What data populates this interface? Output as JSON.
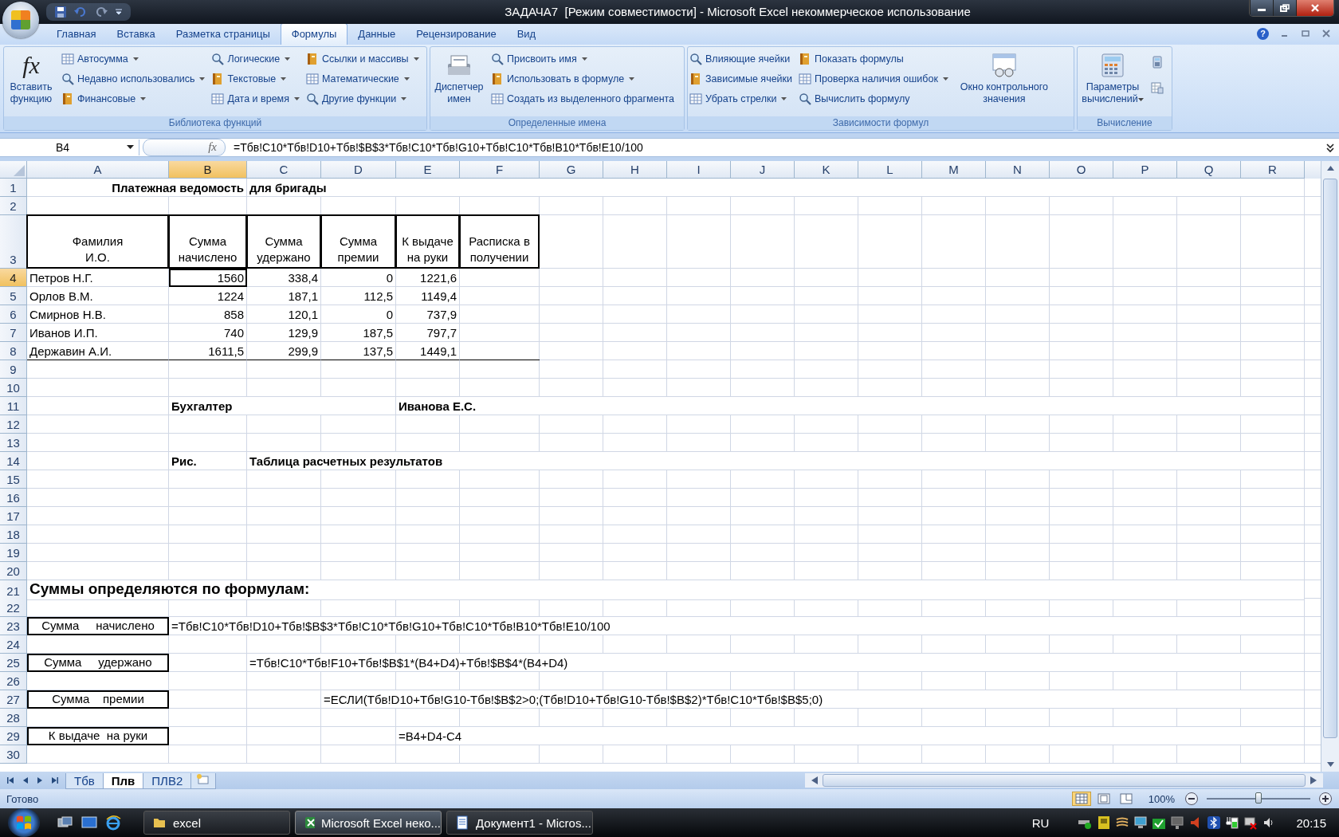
{
  "window": {
    "title": "ЗАДАЧА7  [Режим совместимости] - Microsoft Excel некоммерческое использование"
  },
  "ribbon": {
    "tabs": [
      {
        "label": "Главная",
        "selected": false
      },
      {
        "label": "Вставка",
        "selected": false
      },
      {
        "label": "Разметка страницы",
        "selected": false
      },
      {
        "label": "Формулы",
        "selected": true
      },
      {
        "label": "Данные",
        "selected": false
      },
      {
        "label": "Рецензирование",
        "selected": false
      },
      {
        "label": "Вид",
        "selected": false
      }
    ],
    "help": "?",
    "groups": [
      {
        "label": "Библиотека функций",
        "parts": [
          {
            "kind": "large",
            "glyph": "fx",
            "label": "Вставить функцию",
            "dropdown": false
          },
          {
            "kind": "column",
            "items": [
              {
                "label": "Автосумма",
                "dropdown": true
              },
              {
                "label": "Недавно использовались",
                "dropdown": true
              },
              {
                "label": "Финансовые",
                "dropdown": true
              }
            ]
          },
          {
            "kind": "column",
            "items": [
              {
                "label": "Логические",
                "dropdown": true
              },
              {
                "label": "Текстовые",
                "dropdown": true
              },
              {
                "label": "Дата и время",
                "dropdown": true
              }
            ]
          },
          {
            "kind": "column",
            "items": [
              {
                "label": "Ссылки и массивы",
                "dropdown": true
              },
              {
                "label": "Математические",
                "dropdown": true
              },
              {
                "label": "Другие функции",
                "dropdown": true
              }
            ]
          }
        ]
      },
      {
        "label": "Определенные имена",
        "parts": [
          {
            "kind": "large",
            "label": "Диспетчер имен",
            "dropdown": false
          },
          {
            "kind": "column",
            "items": [
              {
                "label": "Присвоить имя",
                "dropdown": true
              },
              {
                "label": "Использовать в формуле",
                "dropdown": true
              },
              {
                "label": "Создать из выделенного фрагмента",
                "dropdown": false
              }
            ]
          }
        ]
      },
      {
        "label": "Зависимости формул",
        "parts": [
          {
            "kind": "column",
            "items": [
              {
                "label": "Влияющие ячейки",
                "dropdown": false
              },
              {
                "label": "Зависимые ячейки",
                "dropdown": false
              },
              {
                "label": "Убрать стрелки",
                "dropdown": true
              }
            ]
          },
          {
            "kind": "column",
            "items": [
              {
                "label": "Показать формулы",
                "dropdown": false
              },
              {
                "label": "Проверка наличия ошибок",
                "dropdown": true
              },
              {
                "label": "Вычислить формулу",
                "dropdown": false
              }
            ]
          },
          {
            "kind": "large",
            "label": "Окно контрольного значения",
            "dropdown": false
          }
        ]
      },
      {
        "label": "Вычисление",
        "parts": [
          {
            "kind": "large",
            "label": "Параметры вычислений",
            "dropdown": true
          },
          {
            "kind": "icons"
          }
        ]
      }
    ]
  },
  "formula_bar": {
    "name_box": "B4",
    "fx": "fx",
    "value": "=Тбв!C10*Тбв!D10+Тбв!$B$3*Тбв!C10*Тбв!G10+Тбв!C10*Тбв!B10*Тбв!E10/100"
  },
  "sheet": {
    "columns": [
      {
        "label": "A",
        "selected": false
      },
      {
        "label": "B",
        "selected": true
      },
      {
        "label": "C",
        "selected": false
      },
      {
        "label": "D",
        "selected": false
      },
      {
        "label": "E",
        "selected": false
      },
      {
        "label": "F",
        "selected": false
      },
      {
        "label": "G",
        "selected": false
      },
      {
        "label": "H",
        "selected": false
      },
      {
        "label": "I",
        "selected": false
      },
      {
        "label": "J",
        "selected": false
      },
      {
        "label": "K",
        "selected": false
      },
      {
        "label": "L",
        "selected": false
      },
      {
        "label": "M",
        "selected": false
      },
      {
        "label": "N",
        "selected": false
      },
      {
        "label": "O",
        "selected": false
      },
      {
        "label": "P",
        "selected": false
      },
      {
        "label": "Q",
        "selected": false
      },
      {
        "label": "R",
        "selected": false
      }
    ],
    "rows": [
      {
        "number": "1",
        "selected": false,
        "kind": "plain",
        "cells": [
          null,
          {
            "kind": "bold_right",
            "text": "Платежная ведомость"
          },
          {
            "kind": "bold",
            "text": "для бригады"
          }
        ]
      },
      {
        "number": "2",
        "selected": false,
        "kind": "plain",
        "cells": []
      },
      {
        "number": "3",
        "selected": false,
        "kind": "header",
        "cells": [
          {
            "kind": "header",
            "text": "Фамилия\nИ.О."
          },
          {
            "kind": "header",
            "text": "Сумма\nначислено"
          },
          {
            "kind": "header",
            "text": "Сумма\nудержано"
          },
          {
            "kind": "header",
            "text": "Сумма\nпремии"
          },
          {
            "kind": "header",
            "text": "К выдаче\nна руки"
          },
          {
            "kind": "header",
            "text": "Расписка  в\nполучении"
          }
        ]
      },
      {
        "number": "4",
        "selected": true,
        "kind": "plain",
        "cells": [
          {
            "kind": "text",
            "text": "Петров Н.Г."
          },
          {
            "kind": "number",
            "text": "1560"
          },
          {
            "kind": "number",
            "text": "338,4"
          },
          {
            "kind": "number",
            "text": "0"
          },
          {
            "kind": "number",
            "text": "1221,6"
          }
        ]
      },
      {
        "number": "5",
        "selected": false,
        "kind": "plain",
        "cells": [
          {
            "kind": "text",
            "text": "Орлов В.М."
          },
          {
            "kind": "number",
            "text": "1224"
          },
          {
            "kind": "number",
            "text": "187,1"
          },
          {
            "kind": "number",
            "text": "112,5"
          },
          {
            "kind": "number",
            "text": "1149,4"
          }
        ]
      },
      {
        "number": "6",
        "selected": false,
        "kind": "plain",
        "cells": [
          {
            "kind": "text",
            "text": "Смирнов Н.В."
          },
          {
            "kind": "number",
            "text": "858"
          },
          {
            "kind": "number",
            "text": "120,1"
          },
          {
            "kind": "number",
            "text": "0"
          },
          {
            "kind": "number",
            "text": "737,9"
          }
        ]
      },
      {
        "number": "7",
        "selected": false,
        "kind": "plain",
        "cells": [
          {
            "kind": "text",
            "text": "Иванов И.П."
          },
          {
            "kind": "number",
            "text": "740"
          },
          {
            "kind": "number",
            "text": "129,9"
          },
          {
            "kind": "number",
            "text": "187,5"
          },
          {
            "kind": "number",
            "text": "797,7"
          }
        ]
      },
      {
        "number": "8",
        "selected": false,
        "kind": "table_end",
        "cells": [
          {
            "kind": "text",
            "text": "Державин А.И."
          },
          {
            "kind": "number",
            "text": "1611,5"
          },
          {
            "kind": "number",
            "text": "299,9"
          },
          {
            "kind": "number",
            "text": "137,5"
          },
          {
            "kind": "number",
            "text": "1449,1"
          }
        ]
      },
      {
        "number": "9",
        "selected": false,
        "kind": "plain",
        "cells": []
      },
      {
        "number": "10",
        "selected": false,
        "kind": "plain",
        "cells": []
      },
      {
        "number": "11",
        "selected": false,
        "kind": "plain",
        "cells": [
          null,
          {
            "kind": "bold",
            "text": "Бухгалтер"
          },
          null,
          null,
          {
            "kind": "bold",
            "text": "Иванова Е.С."
          }
        ]
      },
      {
        "number": "12",
        "selected": false,
        "kind": "plain",
        "cells": []
      },
      {
        "number": "13",
        "selected": false,
        "kind": "plain",
        "cells": []
      },
      {
        "number": "14",
        "selected": false,
        "kind": "plain",
        "cells": [
          null,
          {
            "kind": "bold",
            "text": "Рис."
          },
          {
            "kind": "bold",
            "text": "Таблица расчетных результатов"
          }
        ]
      },
      {
        "number": "15",
        "selected": false,
        "kind": "plain",
        "cells": []
      },
      {
        "number": "16",
        "selected": false,
        "kind": "plain",
        "cells": []
      },
      {
        "number": "17",
        "selected": false,
        "kind": "plain",
        "cells": []
      },
      {
        "number": "18",
        "selected": false,
        "kind": "plain",
        "cells": []
      },
      {
        "number": "19",
        "selected": false,
        "kind": "plain",
        "cells": []
      },
      {
        "number": "20",
        "selected": false,
        "kind": "plain",
        "cells": []
      },
      {
        "number": "21",
        "selected": false,
        "kind": "plain",
        "cells": [
          {
            "kind": "heading",
            "text": "Суммы определяются по формулам:"
          }
        ]
      },
      {
        "number": "22",
        "selected": false,
        "kind": "plain",
        "cells": []
      },
      {
        "number": "23",
        "selected": false,
        "kind": "plain",
        "cells": [
          {
            "kind": "boxed",
            "text": "Сумма     начислено"
          },
          {
            "kind": "text",
            "text": "=Тбв!C10*Тбв!D10+Тбв!$B$3*Тбв!C10*Тбв!G10+Тбв!C10*Тбв!B10*Тбв!E10/100"
          }
        ]
      },
      {
        "number": "24",
        "selected": false,
        "kind": "plain",
        "cells": []
      },
      {
        "number": "25",
        "selected": false,
        "kind": "plain",
        "cells": [
          {
            "kind": "boxed",
            "text": "Сумма     удержано"
          },
          null,
          {
            "kind": "text",
            "text": "=Тбв!C10*Тбв!F10+Тбв!$B$1*(B4+D4)+Тбв!$B$4*(B4+D4)"
          }
        ]
      },
      {
        "number": "26",
        "selected": false,
        "kind": "plain",
        "cells": []
      },
      {
        "number": "27",
        "selected": false,
        "kind": "plain",
        "cells": [
          {
            "kind": "boxed",
            "text": "Сумма    премии"
          },
          null,
          null,
          {
            "kind": "text",
            "text": "=ЕСЛИ(Тбв!D10+Тбв!G10-Тбв!$B$2>0;(Тбв!D10+Тбв!G10-Тбв!$B$2)*Тбв!C10*Тбв!$B$5;0)"
          }
        ]
      },
      {
        "number": "28",
        "selected": false,
        "kind": "plain",
        "cells": []
      },
      {
        "number": "29",
        "selected": false,
        "kind": "plain",
        "cells": [
          {
            "kind": "boxed",
            "text": "К выдаче  на руки"
          },
          null,
          null,
          null,
          {
            "kind": "text",
            "text": "=B4+D4-C4"
          }
        ]
      },
      {
        "number": "30",
        "selected": false,
        "kind": "plain",
        "cells": []
      }
    ],
    "tabs": [
      {
        "label": "Тбв",
        "selected": false
      },
      {
        "label": "Плв",
        "selected": true
      },
      {
        "label": "ПЛВ2",
        "selected": false
      }
    ]
  },
  "status_bar": {
    "text": "Готово",
    "views": [
      {
        "selected": true
      },
      {
        "selected": false
      },
      {
        "selected": false
      }
    ],
    "zoom": "100%",
    "zoom_slider": {
      "level": 0.5
    }
  },
  "taskbar": {
    "tasks": [
      {
        "label": "excel",
        "selected": false
      },
      {
        "label": "Microsoft Excel неко...",
        "selected": true
      },
      {
        "label": "Документ1 - Micros...",
        "selected": false
      }
    ],
    "language": "RU",
    "clock": "20:15"
  }
}
